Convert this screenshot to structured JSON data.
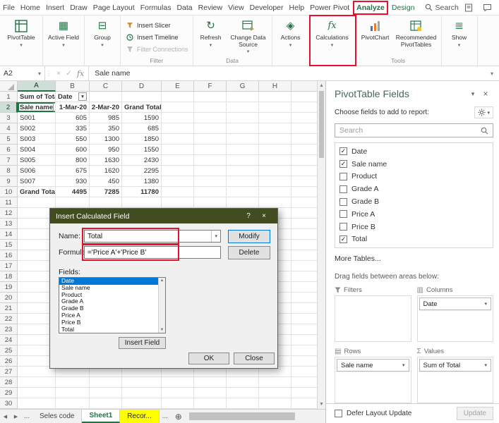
{
  "menu": {
    "tabs": [
      {
        "label": "File",
        "style": "normal"
      },
      {
        "label": "Home",
        "style": "normal"
      },
      {
        "label": "Insert",
        "style": "normal"
      },
      {
        "label": "Draw",
        "style": "normal"
      },
      {
        "label": "Page Layout",
        "style": "normal"
      },
      {
        "label": "Formulas",
        "style": "normal"
      },
      {
        "label": "Data",
        "style": "normal"
      },
      {
        "label": "Review",
        "style": "normal"
      },
      {
        "label": "View",
        "style": "normal"
      },
      {
        "label": "Developer",
        "style": "normal"
      },
      {
        "label": "Help",
        "style": "normal"
      },
      {
        "label": "Power Pivot",
        "style": "normal"
      },
      {
        "label": "Analyze",
        "style": "active"
      },
      {
        "label": "Design",
        "style": "contextual"
      }
    ],
    "search_label": "Search"
  },
  "ribbon": {
    "pivottable_label": "PivotTable",
    "active_field_label": "Active Field",
    "group_label": "Group",
    "insert_slicer_label": "Insert Slicer",
    "insert_timeline_label": "Insert Timeline",
    "filter_connections_label": "Filter Connections",
    "filter_group_label": "Filter",
    "refresh_label": "Refresh",
    "change_data_source_label": "Change Data Source",
    "data_group_label": "Data",
    "actions_label": "Actions",
    "calculations_label": "Calculations",
    "pivotchart_label": "PivotChart",
    "recommended_label": "Recommended PivotTables",
    "tools_group_label": "Tools",
    "show_label": "Show"
  },
  "formula_bar": {
    "name_box_value": "A2",
    "formula_content": "Sale name"
  },
  "grid": {
    "column_headers": [
      "A",
      "B",
      "C",
      "D",
      "E",
      "F",
      "G",
      "H"
    ],
    "row_count": 30,
    "selected_cell": "A2"
  },
  "pivot": {
    "row1": {
      "a": "Sum of Total",
      "b": "Date"
    },
    "header_row": [
      "Sale name",
      "1-Mar-20",
      "2-Mar-20",
      "Grand Total"
    ],
    "data_rows": [
      [
        "S001",
        "605",
        "985",
        "1590"
      ],
      [
        "S002",
        "335",
        "350",
        "685"
      ],
      [
        "S003",
        "550",
        "1300",
        "1850"
      ],
      [
        "S004",
        "600",
        "950",
        "1550"
      ],
      [
        "S005",
        "800",
        "1630",
        "2430"
      ],
      [
        "S006",
        "675",
        "1620",
        "2295"
      ],
      [
        "S007",
        "930",
        "450",
        "1380"
      ]
    ],
    "total_row": [
      "Grand Total",
      "4495",
      "7285",
      "11780"
    ]
  },
  "dialog": {
    "title": "Insert Calculated Field",
    "name_label": "Name:",
    "name_value": "Total",
    "formula_label": "Formula:",
    "formula_value": "='Price A'+'Price B'",
    "modify_button": "Modify",
    "delete_button": "Delete",
    "fields_label": "Fields:",
    "fields": [
      "Date",
      "Sale name",
      "Product",
      "Grade A",
      "Grade B",
      "Price A",
      "Price B",
      "Total"
    ],
    "selected_field_index": 0,
    "insert_field_button": "Insert Field",
    "ok_button": "OK",
    "close_button": "Close",
    "help_button": "?",
    "close_x": "×"
  },
  "fields_panel": {
    "title": "PivotTable Fields",
    "choose_label": "Choose fields to add to report:",
    "search_placeholder": "Search",
    "fields": [
      {
        "name": "Date",
        "checked": true
      },
      {
        "name": "Sale name",
        "checked": true
      },
      {
        "name": "Product",
        "checked": false
      },
      {
        "name": "Grade A",
        "checked": false
      },
      {
        "name": "Grade B",
        "checked": false
      },
      {
        "name": "Price A",
        "checked": false
      },
      {
        "name": "Price B",
        "checked": false
      },
      {
        "name": "Total",
        "checked": true
      }
    ],
    "more_tables_label": "More Tables...",
    "drag_label": "Drag fields between areas below:",
    "areas": {
      "filters_label": "Filters",
      "columns_label": "Columns",
      "columns_items": [
        "Date"
      ],
      "rows_label": "Rows",
      "rows_items": [
        "Sale name"
      ],
      "values_label": "Values",
      "values_items": [
        "Sum of Total"
      ]
    },
    "defer_label": "Defer Layout Update",
    "update_button": "Update"
  },
  "sheet_bar": {
    "ellipsis_left": "...",
    "tabs": [
      {
        "label": "Seles code",
        "style": "normal"
      },
      {
        "label": "Sheet1",
        "style": "active"
      },
      {
        "label": "Recor...",
        "style": "yellow"
      }
    ],
    "ellipsis_right": "...",
    "add_sheet": "⊕"
  },
  "colors": {
    "excel_green": "#217346",
    "annotation_red": "#e8112d",
    "dialog_title_bg": "#414d21",
    "selection_blue": "#0078d7",
    "tab_highlight_yellow": "#ffff00"
  }
}
